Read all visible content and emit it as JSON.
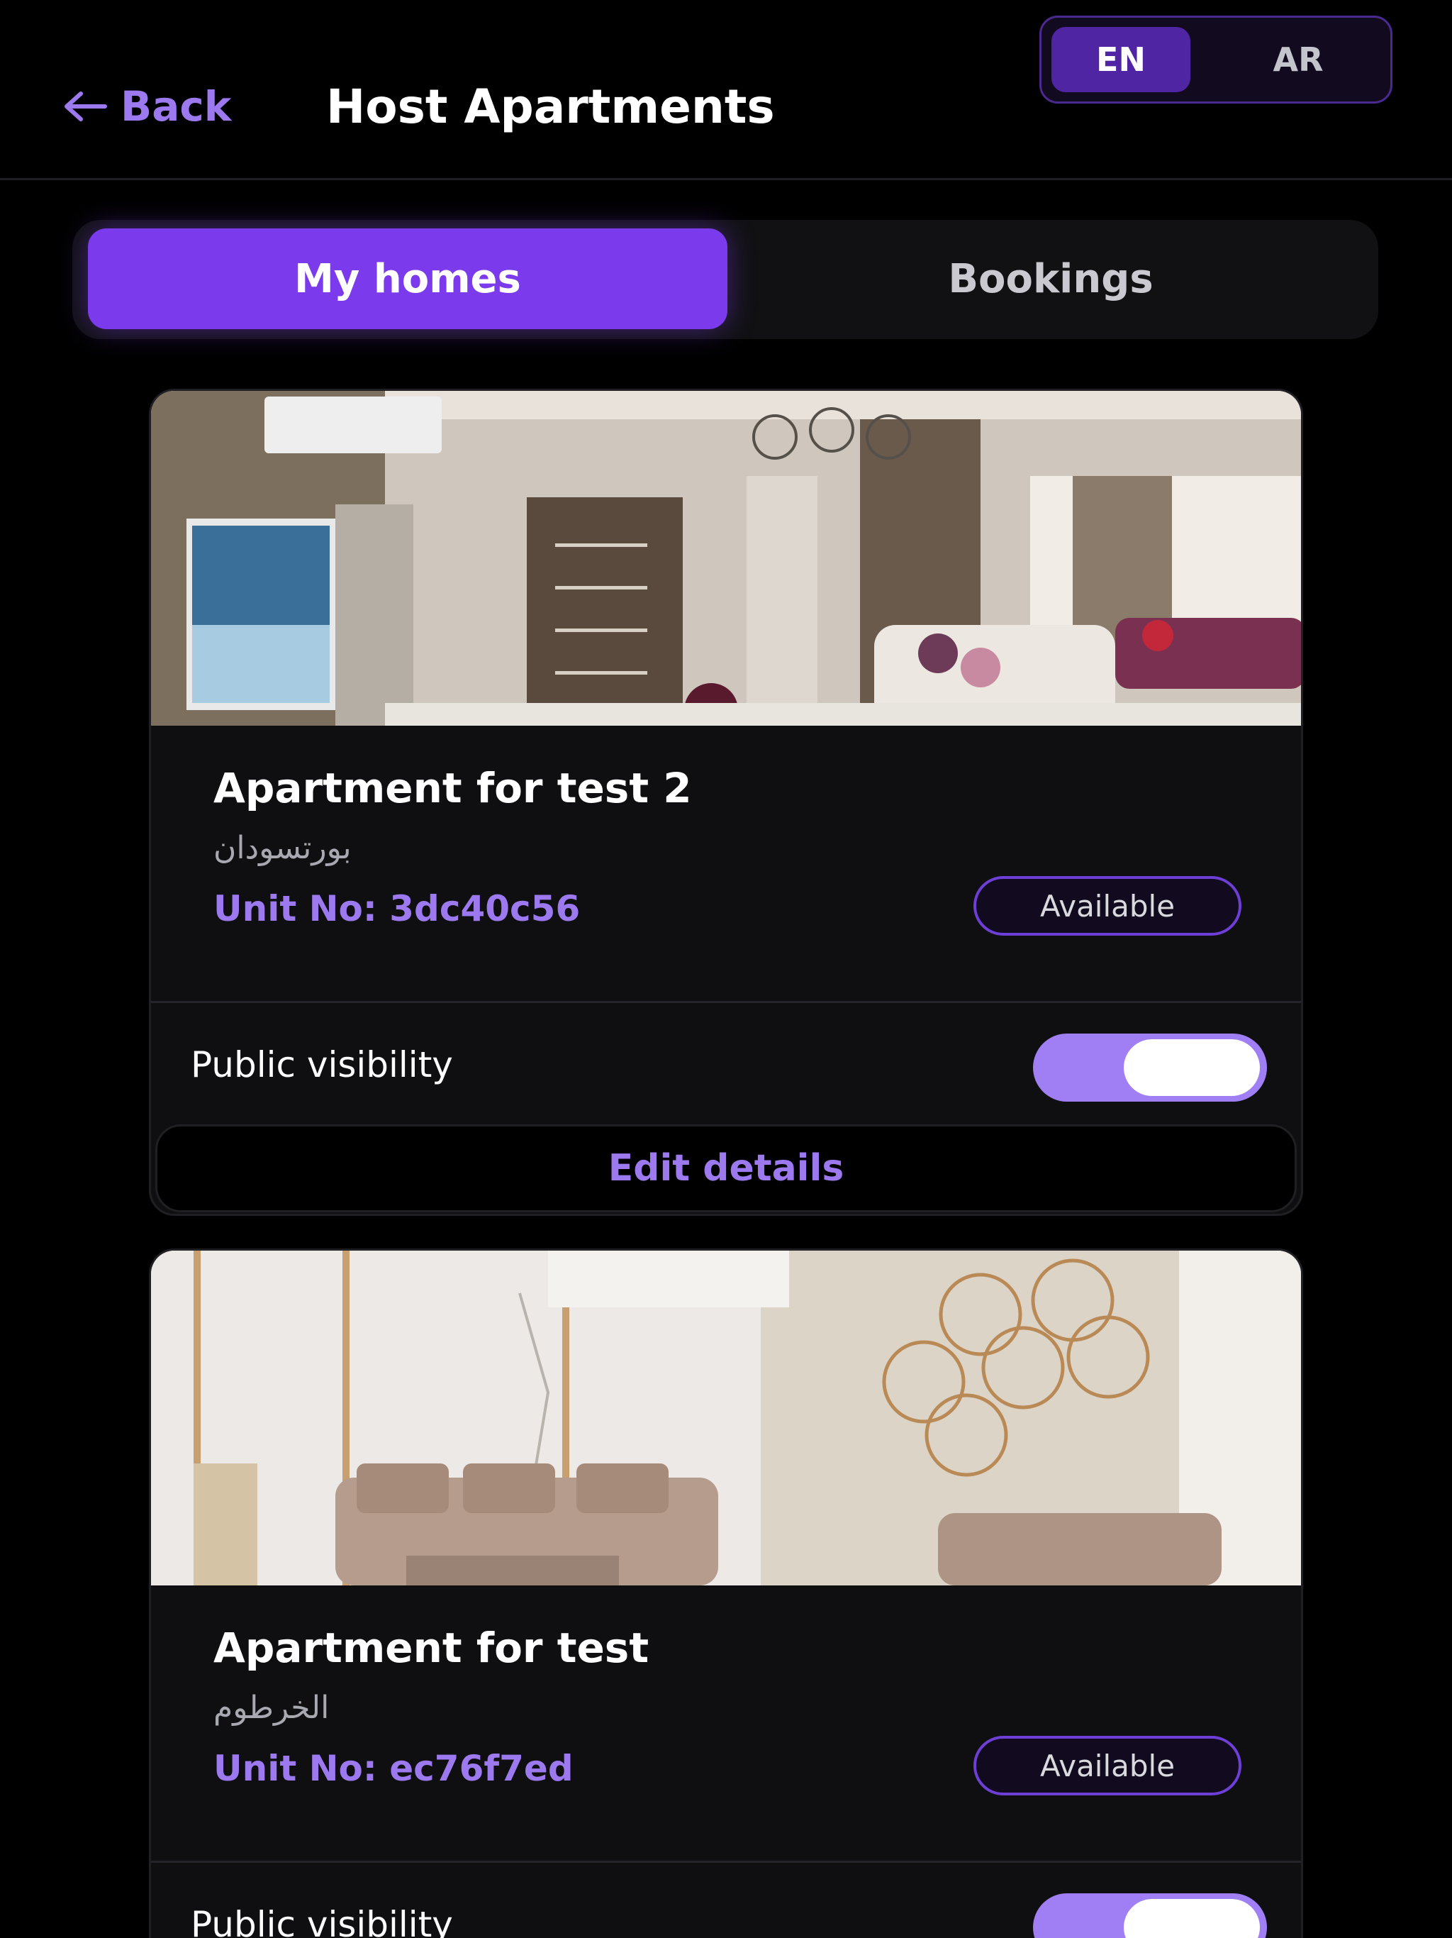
{
  "header": {
    "back_label": "Back",
    "title": "Host Apartments",
    "languages": [
      "EN",
      "AR"
    ],
    "active_language": "EN"
  },
  "tabs": [
    {
      "label": "My homes",
      "active": true
    },
    {
      "label": "Bookings",
      "active": false
    }
  ],
  "listings": [
    {
      "title": "Apartment for test 2",
      "location": "بورتسودان",
      "unit": "Unit No: 3dc40c56",
      "status": "Available",
      "visibility_label": "Public visibility",
      "public_visible": true,
      "edit_label": "Edit details"
    },
    {
      "title": "Apartment for test",
      "location": "الخرطوم",
      "unit": "Unit No: ec76f7ed",
      "status": "Available",
      "visibility_label": "Public visibility",
      "public_visible": true
    }
  ],
  "colors": {
    "accent": "#7c3aed",
    "accent_text": "#9d79f0",
    "toggle_on": "#a07ff5",
    "background": "#000000",
    "card": "#0f0f11"
  }
}
